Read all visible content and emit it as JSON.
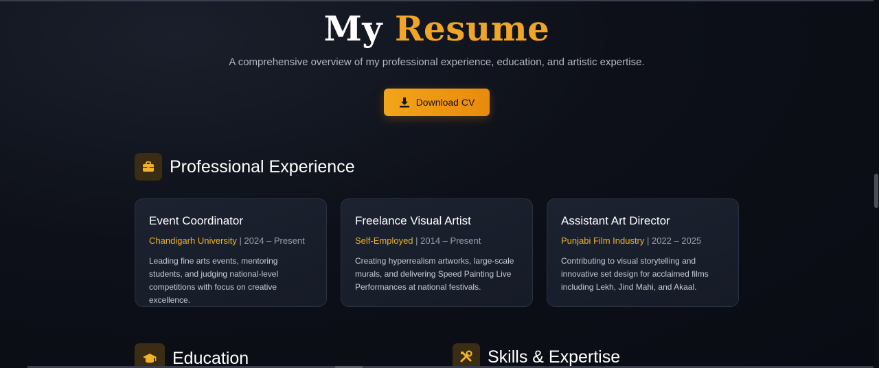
{
  "hero": {
    "title_part1": "My",
    "title_part2": "Resume",
    "subtitle": "A comprehensive overview of my professional experience, education, and artistic expertise.",
    "download_label": "Download CV"
  },
  "colors": {
    "accent": "#f0a526",
    "background": "#0d1018",
    "card": "#1a1f2c"
  },
  "sections": {
    "experience": {
      "title": "Professional Experience",
      "icon": "briefcase-icon"
    },
    "education": {
      "title": "Education",
      "icon": "graduation-cap-icon"
    },
    "skills": {
      "title": "Skills & Expertise",
      "icon": "tools-icon"
    }
  },
  "experience": [
    {
      "role": "Event Coordinator",
      "org": "Chandigarh University",
      "period": " | 2024 – Present",
      "desc": "Leading fine arts events, mentoring students, and judging national-level competitions with focus on creative excellence."
    },
    {
      "role": "Freelance Visual Artist",
      "org": "Self-Employed",
      "period": " | 2014 – Present",
      "desc": "Creating hyperrealism artworks, large-scale murals, and delivering Speed Painting Live Performances at national festivals."
    },
    {
      "role": "Assistant Art Director",
      "org": "Punjabi Film Industry",
      "period": " | 2022 – 2025",
      "desc": "Contributing to visual storytelling and innovative set design for acclaimed films including Lekh, Jind Mahi, and Akaal."
    }
  ]
}
